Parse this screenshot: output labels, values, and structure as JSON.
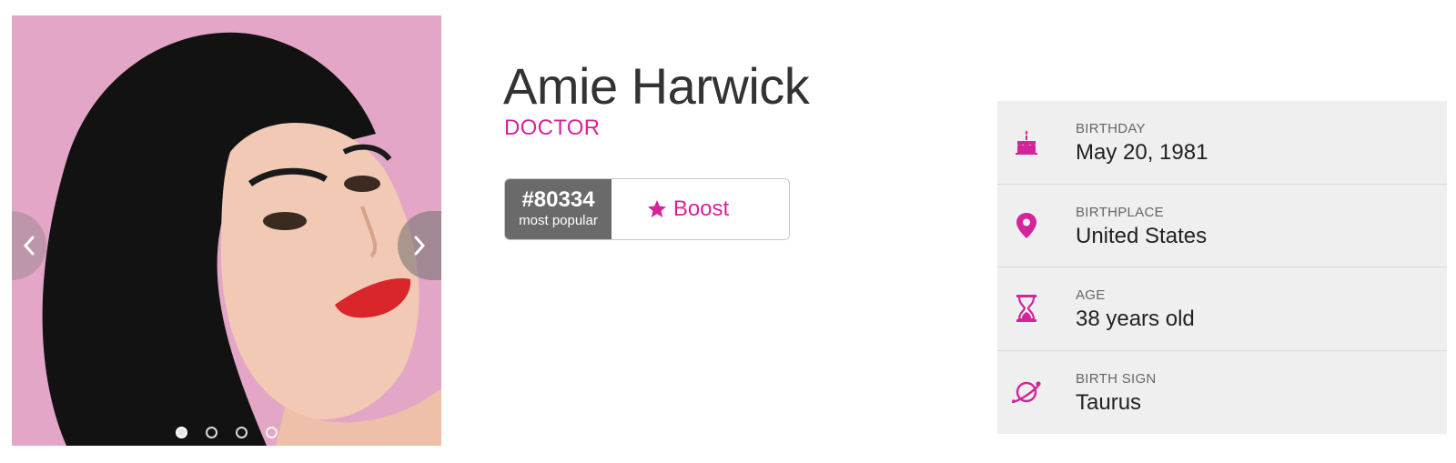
{
  "profile": {
    "name": "Amie Harwick",
    "profession": "DOCTOR",
    "rank_number": "#80334",
    "rank_label": "most popular",
    "boost_label": "Boost"
  },
  "carousel": {
    "photo_alt": "Amie Harwick",
    "slide_count": 4,
    "active_slide": 1
  },
  "info": {
    "items": [
      {
        "label": "BIRTHDAY",
        "value": "May 20, 1981",
        "icon": "cake-icon"
      },
      {
        "label": "BIRTHPLACE",
        "value": "United States",
        "icon": "location-pin-icon"
      },
      {
        "label": "AGE",
        "value": "38 years old",
        "icon": "hourglass-icon"
      },
      {
        "label": "BIRTH SIGN",
        "value": "Taurus",
        "icon": "planet-icon"
      }
    ]
  },
  "colors": {
    "accent": "#d4249a",
    "rank_bg": "#6a6a6a",
    "panel_bg": "#efefef"
  }
}
